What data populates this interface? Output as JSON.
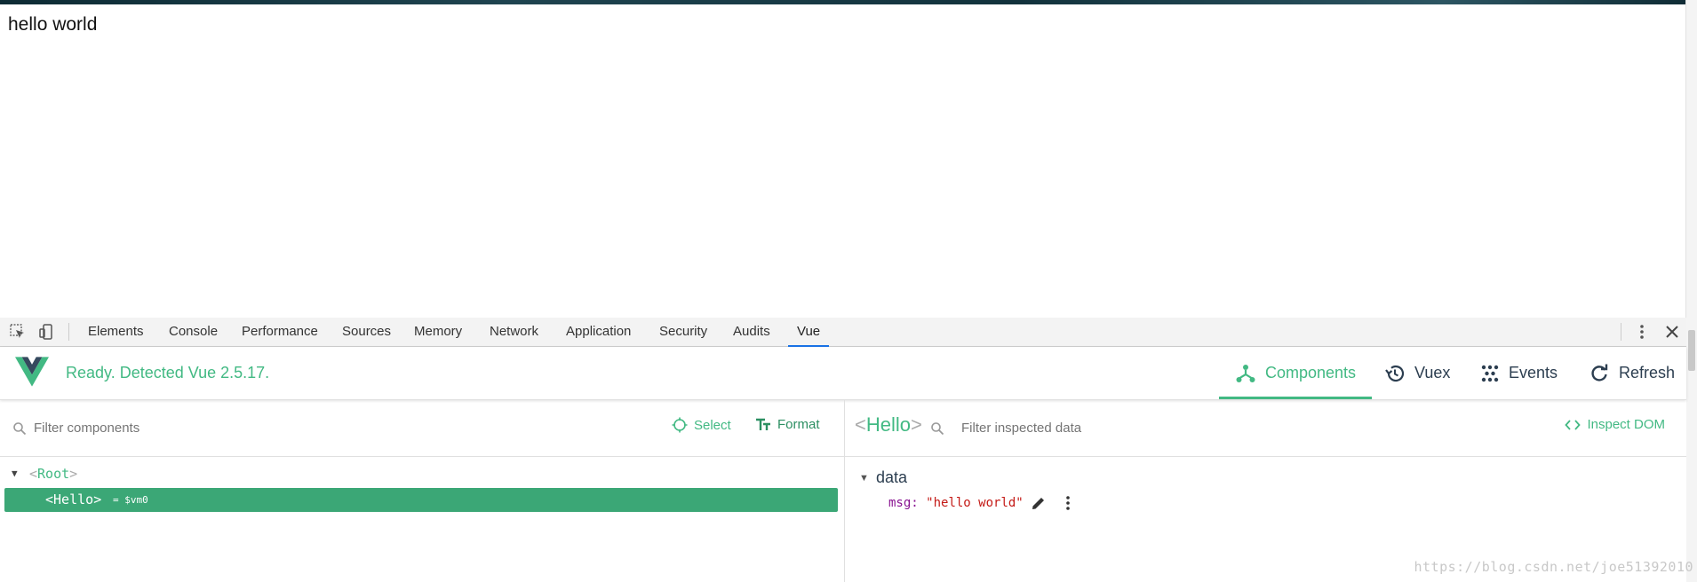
{
  "page": {
    "text": "hello world"
  },
  "devtools": {
    "tabs": [
      "Elements",
      "Console",
      "Performance",
      "Sources",
      "Memory",
      "Network",
      "Application",
      "Security",
      "Audits",
      "Vue"
    ],
    "active_tab": "Vue"
  },
  "vue": {
    "status": "Ready. Detected Vue 2.5.17.",
    "nav": {
      "components": "Components",
      "vuex": "Vuex",
      "events": "Events",
      "refresh": "Refresh"
    },
    "left": {
      "filter_placeholder": "Filter components",
      "select": "Select",
      "format": "Format",
      "tree": {
        "root": "Root",
        "child": "Hello",
        "child_ref": "= $vm0"
      }
    },
    "right": {
      "component": "Hello",
      "filter_placeholder": "Filter inspected data",
      "inspect_dom": "Inspect DOM",
      "section": "data",
      "props": [
        {
          "key": "msg",
          "value": "\"hello world\""
        }
      ]
    }
  },
  "watermark": "https://blog.csdn.net/joe51392010",
  "colors": {
    "vue_green": "#42b983",
    "selected_row": "#3ba776",
    "chrome_accent": "#1a73e8"
  }
}
